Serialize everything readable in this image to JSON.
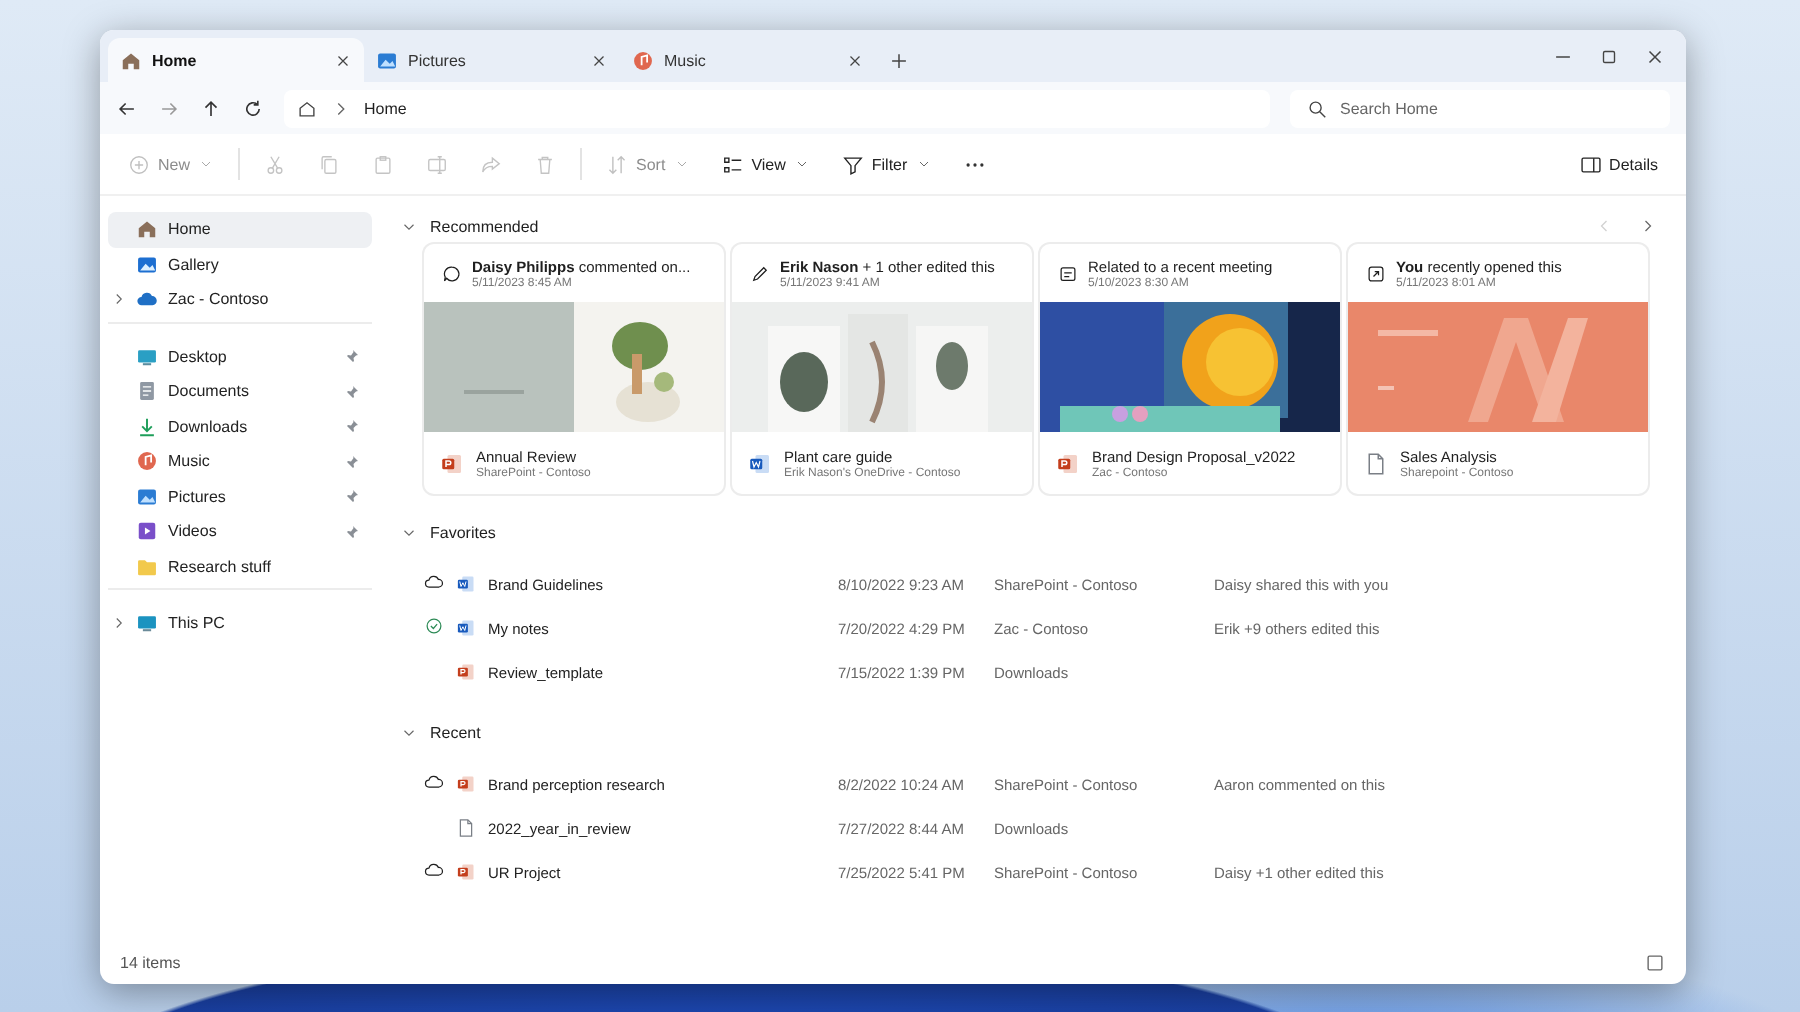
{
  "tabs": [
    {
      "label": "Home",
      "selected": true
    },
    {
      "label": "Pictures",
      "selected": false
    },
    {
      "label": "Music",
      "selected": false
    }
  ],
  "address": {
    "path": "Home"
  },
  "search": {
    "placeholder": "Search Home"
  },
  "toolbar": [
    {
      "kind": "new",
      "label": "New",
      "disabled": true
    },
    {
      "kind": "separator"
    },
    {
      "kind": "cut",
      "disabled": true
    },
    {
      "kind": "copy",
      "disabled": true
    },
    {
      "kind": "paste",
      "disabled": true
    },
    {
      "kind": "rename",
      "disabled": true
    },
    {
      "kind": "share",
      "disabled": true
    },
    {
      "kind": "delete",
      "disabled": true
    },
    {
      "kind": "separator"
    },
    {
      "kind": "sort",
      "label": "Sort",
      "disabled": true
    },
    {
      "kind": "view",
      "label": "View",
      "disabled": false
    },
    {
      "kind": "filter",
      "label": "Filter",
      "disabled": false
    },
    {
      "kind": "more",
      "disabled": false
    }
  ],
  "details": {
    "label": "Details"
  },
  "sidebar": [
    {
      "items": [
        {
          "kind": "home",
          "label": "Home",
          "selected": true,
          "pinned": false,
          "expandable": false
        },
        {
          "kind": "gallery",
          "label": "Gallery",
          "selected": false,
          "pinned": false,
          "expandable": false
        },
        {
          "kind": "cloud",
          "label": "Zac - Contoso",
          "selected": false,
          "pinned": false,
          "expandable": true
        }
      ]
    },
    {
      "items": [
        {
          "kind": "desktop",
          "label": "Desktop",
          "selected": false,
          "pinned": true,
          "expandable": false
        },
        {
          "kind": "documents",
          "label": "Documents",
          "selected": false,
          "pinned": true,
          "expandable": false
        },
        {
          "kind": "downloads",
          "label": "Downloads",
          "selected": false,
          "pinned": true,
          "expandable": false
        },
        {
          "kind": "music",
          "label": "Music",
          "selected": false,
          "pinned": true,
          "expandable": false
        },
        {
          "kind": "pictures",
          "label": "Pictures",
          "selected": false,
          "pinned": true,
          "expandable": false
        },
        {
          "kind": "videos",
          "label": "Videos",
          "selected": false,
          "pinned": true,
          "expandable": false
        },
        {
          "kind": "folder",
          "label": "Research stuff",
          "selected": false,
          "pinned": false,
          "expandable": false
        }
      ]
    },
    {
      "items": [
        {
          "kind": "pc",
          "label": "This PC",
          "selected": false,
          "pinned": false,
          "expandable": true
        }
      ]
    }
  ],
  "recommended": {
    "title": "Recommended",
    "expanded": true,
    "pager": [
      {
        "disabled": true
      },
      {
        "disabled": false
      }
    ],
    "cards": [
      {
        "kind": "ppt",
        "activity": "**Daisy Philipps** commented on...",
        "time": "5/11/2023 8:45 AM",
        "name": "Annual Review",
        "location": "SharePoint - Contoso"
      },
      {
        "kind": "word",
        "activity": "**Erik Nason** + 1 other edited this",
        "time": "5/11/2023 9:41 AM",
        "name": "Plant care guide",
        "location": "Erik Nason's OneDrive - Contoso"
      },
      {
        "kind": "ppt",
        "activity": "Related to a recent meeting",
        "time": "5/10/2023 8:30 AM",
        "name": "Brand Design Proposal_v2022",
        "location": "Zac - Contoso"
      },
      {
        "kind": "file",
        "activity": "**You** recently opened this",
        "time": "5/11/2023 8:01 AM",
        "name": "Sales Analysis",
        "location": "Sharepoint - Contoso"
      }
    ]
  },
  "lists": [
    {
      "title": "Favorites",
      "expanded": true,
      "rows": [
        {
          "kind": "word",
          "in_cloud": true,
          "synced": false,
          "name": "Brand Guidelines",
          "date": "8/10/2022 9:23 AM",
          "location": "SharePoint - Contoso",
          "activity": "Daisy shared this with you"
        },
        {
          "kind": "word",
          "in_cloud": false,
          "synced": true,
          "name": "My notes",
          "date": "7/20/2022 4:29 PM",
          "location": "Zac - Contoso",
          "activity": "Erik +9 others edited this"
        },
        {
          "kind": "ppt",
          "in_cloud": false,
          "synced": false,
          "name": "Review_template",
          "date": "7/15/2022 1:39 PM",
          "location": "Downloads"
        }
      ]
    },
    {
      "title": "Recent",
      "expanded": true,
      "rows": [
        {
          "kind": "ppt",
          "in_cloud": true,
          "synced": false,
          "name": "Brand perception research",
          "date": "8/2/2022 10:24 AM",
          "location": "SharePoint - Contoso",
          "activity": "Aaron commented on this"
        },
        {
          "kind": "file",
          "in_cloud": false,
          "synced": false,
          "name": "2022_year_in_review",
          "date": "7/27/2022 8:44 AM",
          "location": "Downloads"
        },
        {
          "kind": "ppt",
          "in_cloud": true,
          "synced": false,
          "name": "UR Project",
          "date": "7/25/2022 5:41 PM",
          "location": "SharePoint - Contoso",
          "activity": "Daisy +1 other edited this"
        }
      ]
    }
  ],
  "status_bar": {
    "count": "14 items"
  }
}
